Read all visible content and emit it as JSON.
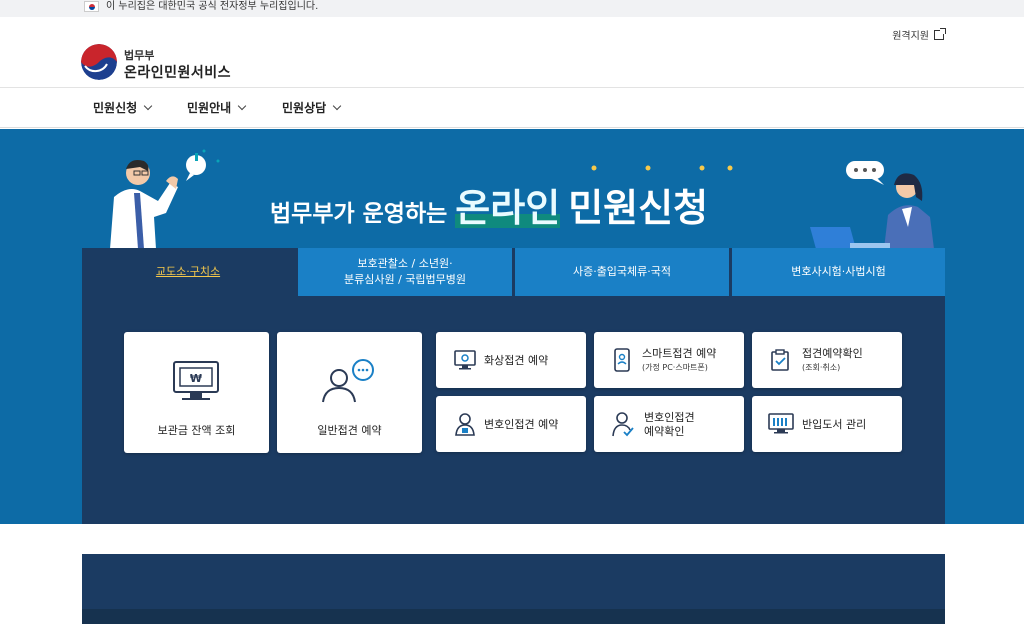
{
  "gov_banner": {
    "text": "이 누리집은 대한민국 공식 전자정부 누리집입니다."
  },
  "header": {
    "remote_support": "원격지원",
    "logo_top": "법무부",
    "logo_main": "온라인민원서비스"
  },
  "nav": {
    "items": [
      {
        "label": "민원신청"
      },
      {
        "label": "민원안내"
      },
      {
        "label": "민원상담"
      }
    ]
  },
  "hero": {
    "title_prefix": "법무부가 운영하는",
    "title_emph1": "온라인",
    "title_emph2": "민원신청"
  },
  "tabs": [
    {
      "label_line1": "교도소·구치소",
      "label_line2": ""
    },
    {
      "label_line1": "보호관찰소 / 소년원·",
      "label_line2": "분류심사원 / 국립법무병원"
    },
    {
      "label_line1": "사증·출입국체류·국적",
      "label_line2": ""
    },
    {
      "label_line1": "변호사시험·사법시험",
      "label_line2": ""
    }
  ],
  "cards": {
    "balance": {
      "label": "보관금 잔액 조회"
    },
    "general_visit": {
      "label": "일반접견 예약"
    },
    "video_visit": {
      "label": "화상접견 예약"
    },
    "smart_visit": {
      "label": "스마트접견 예약",
      "sub": "(가정 PC·스마트폰)"
    },
    "visit_confirm": {
      "label": "접견예약확인",
      "sub": "(조회·취소)"
    },
    "lawyer_visit": {
      "label": "변호인접견 예약"
    },
    "lawyer_confirm": {
      "label1": "변호인접견",
      "label2": "예약확인"
    },
    "books": {
      "label": "반입도서 관리"
    }
  },
  "colors": {
    "hero_bg": "#0d6ba6",
    "panel_bg": "#1b3b62",
    "tab_bg": "#1a80c6",
    "active_tab_text": "#f6c94b"
  }
}
